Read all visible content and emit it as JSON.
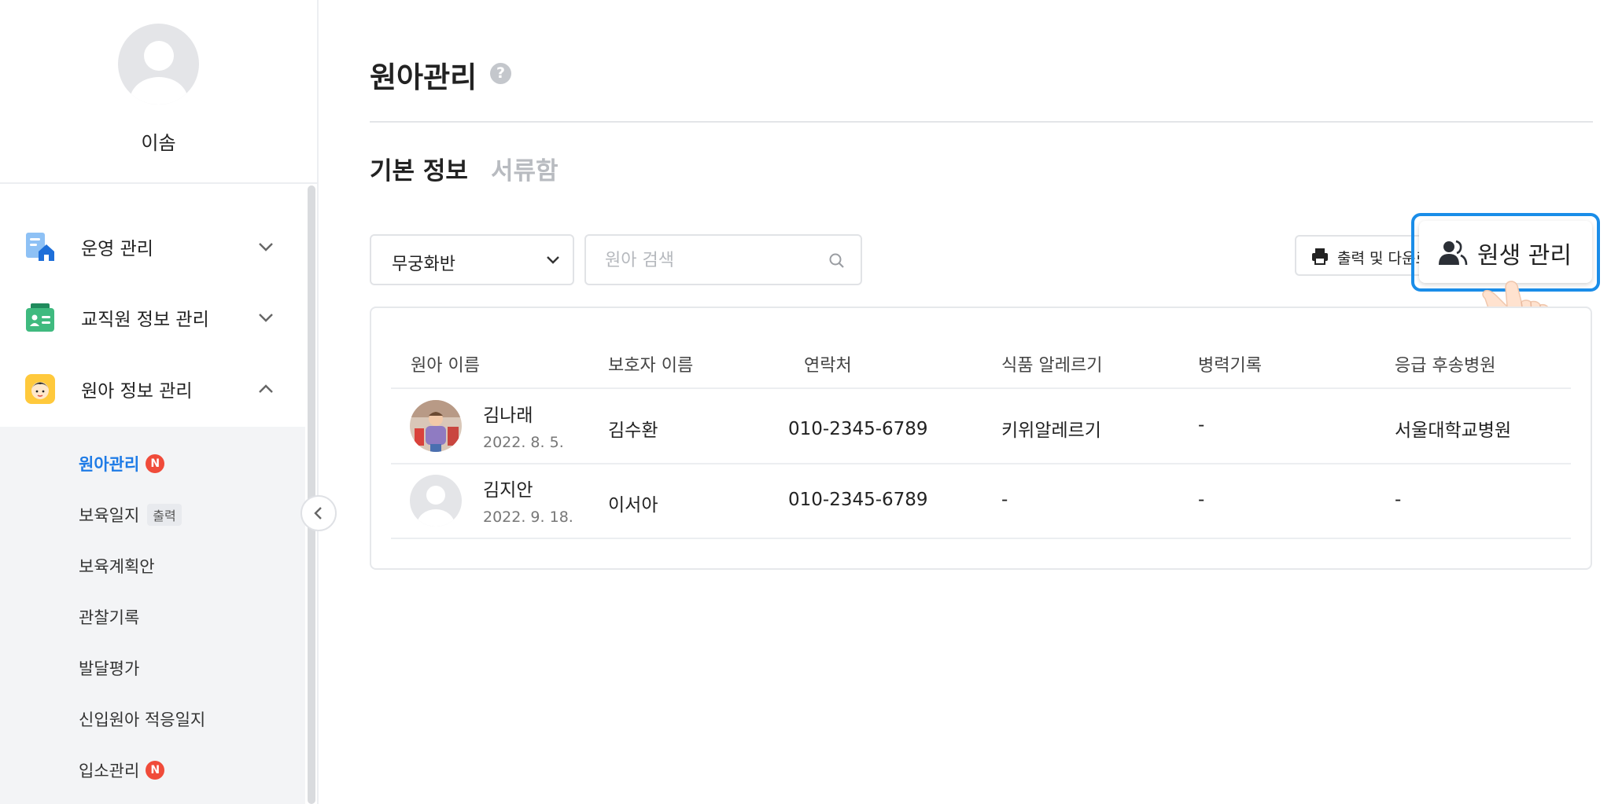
{
  "sidebar": {
    "user_name": "이솜",
    "groups": [
      {
        "label": "운영 관리",
        "icon": "building-document-icon",
        "expanded": false
      },
      {
        "label": "교직원 정보 관리",
        "icon": "staff-id-card-icon",
        "expanded": false
      },
      {
        "label": "원아 정보 관리",
        "icon": "child-face-icon",
        "expanded": true
      }
    ],
    "items": [
      {
        "label": "원아관리",
        "active": true,
        "badge": "N"
      },
      {
        "label": "보육일지",
        "tag": "출력"
      },
      {
        "label": "보육계획안"
      },
      {
        "label": "관찰기록"
      },
      {
        "label": "발달평가"
      },
      {
        "label": "신입원아 적응일지"
      },
      {
        "label": "입소관리",
        "badge": "N"
      }
    ]
  },
  "main": {
    "title": "원아관리",
    "help": "?",
    "tabs": [
      {
        "label": "기본 정보",
        "active": true
      },
      {
        "label": "서류함",
        "active": false
      }
    ],
    "class_select": {
      "value": "무궁화반"
    },
    "search": {
      "placeholder": "원아 검색",
      "value": ""
    },
    "print_button": "출력 및 다운로드",
    "manage_button": "원생 관리",
    "table": {
      "headers": [
        "원아 이름",
        "보호자 이름",
        "연락처",
        "식품 알레르기",
        "병력기록",
        "응급 후송병원"
      ],
      "rows": [
        {
          "name": "김나래",
          "date": "2022. 8. 5.",
          "guardian": "김수환",
          "phone": "010-2345-6789",
          "allergy": "키위알레르기",
          "history": "-",
          "hospital": "서울대학교병원",
          "avatar": "photo"
        },
        {
          "name": "김지안",
          "date": "2022. 9. 18.",
          "guardian": "이서아",
          "phone": "010-2345-6789",
          "allergy": "-",
          "history": "-",
          "hospital": "-",
          "avatar": "placeholder"
        }
      ]
    }
  },
  "colors": {
    "accent": "#1e7be6",
    "highlight_border": "#1a8de8",
    "badge": "#f04b3a",
    "sub_nav_bg": "#f3f4f6"
  }
}
